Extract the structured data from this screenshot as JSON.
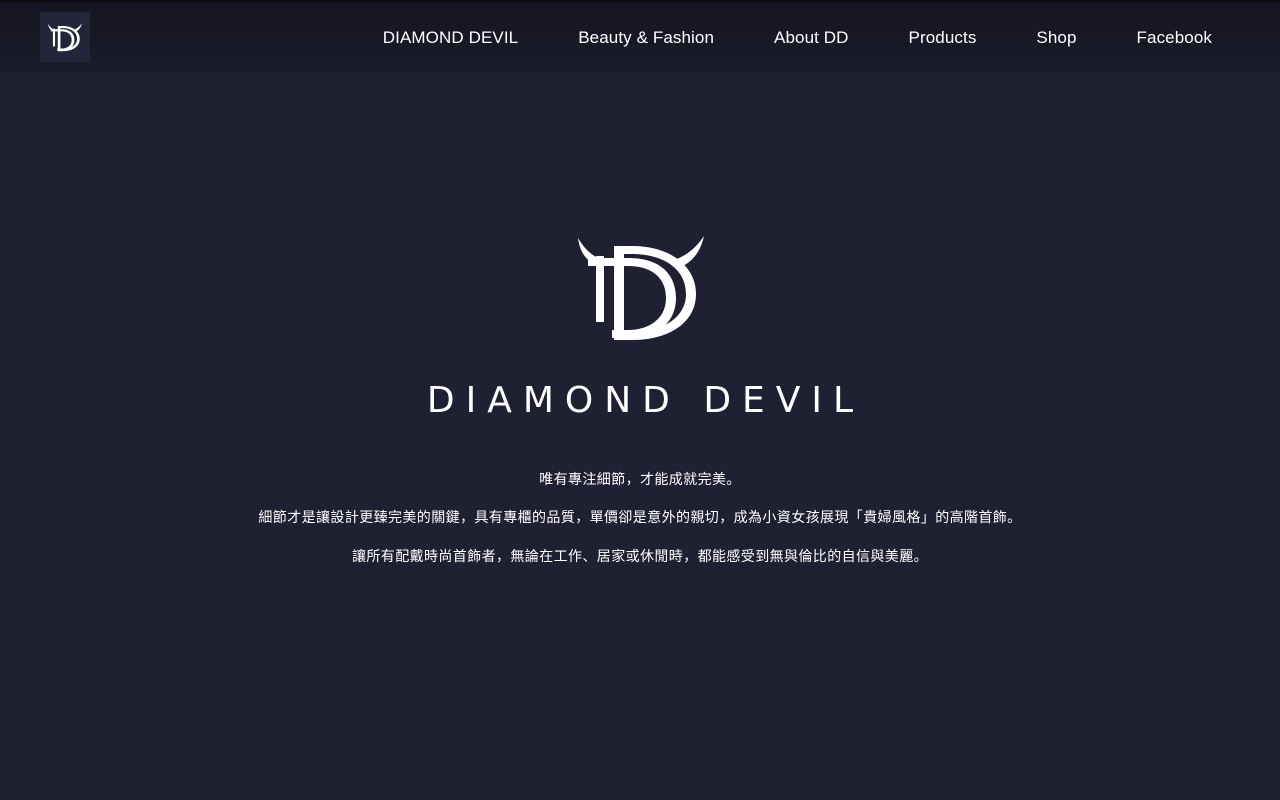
{
  "header": {
    "logo_icon": "dd-devil-logo-icon",
    "nav": [
      {
        "label": "DIAMOND DEVIL"
      },
      {
        "label": "Beauty & Fashion"
      },
      {
        "label": "About DD"
      },
      {
        "label": "Products"
      },
      {
        "label": "Shop"
      },
      {
        "label": "Facebook"
      }
    ]
  },
  "hero": {
    "logo_icon": "dd-devil-logo-icon",
    "brand_name": "DIAMOND DEVIL",
    "lines": [
      "唯有專注細節，才能成就完美。",
      "細節才是讓設計更臻完美的關鍵，具有專櫃的品質，單價卻是意外的親切，成為小資女孩展現「貴婦風格」的高階首飾。",
      "讓所有配戴時尚首飾者，無論在工作、居家或休閒時，都能感受到無與倫比的自信與美麗。"
    ]
  },
  "colors": {
    "background": "#1f2133",
    "header_background": "#151622",
    "text": "#ffffff"
  }
}
